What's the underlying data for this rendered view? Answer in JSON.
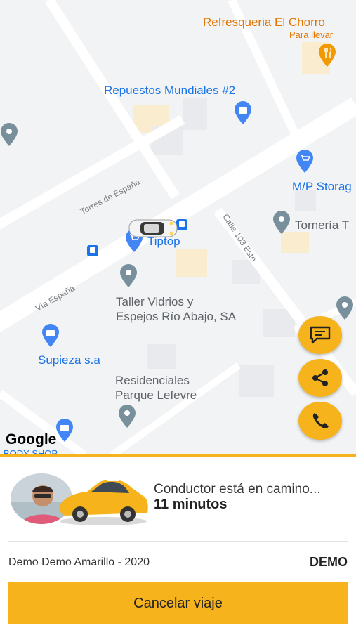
{
  "map": {
    "places": {
      "refresqueria": "Refresqueria El Chorro",
      "para_llevar": "Para llevar",
      "repuestos": "Repuestos Mundiales #2",
      "mp_storage": "M/P Storag",
      "torneria": "Tornería T",
      "tiptop": "Tiptop",
      "taller": "Taller Vidrios y\nEspejos Río Abajo, SA",
      "supieza": "Supieza s.a",
      "residenciales": "Residenciales\nParque Lefevre",
      "body_shop": "BODY SHOP"
    },
    "streets": {
      "torres": "Torres de España",
      "via_espana": "Vía España",
      "calle103": "Calle 103 Este"
    },
    "logo": "Google"
  },
  "actions": {
    "chat": "chat-bubble-icon",
    "share": "share-icon",
    "call": "phone-icon"
  },
  "trip": {
    "status": "Conductor está en camino...",
    "eta": "11 minutos",
    "vehicle": "Demo Demo Amarillo - 2020",
    "plate": "DEMO",
    "cancel_label": "Cancelar viaje"
  },
  "colors": {
    "accent": "#f6b31b",
    "map_blue": "#1a73e8",
    "map_orange": "#e37400"
  }
}
